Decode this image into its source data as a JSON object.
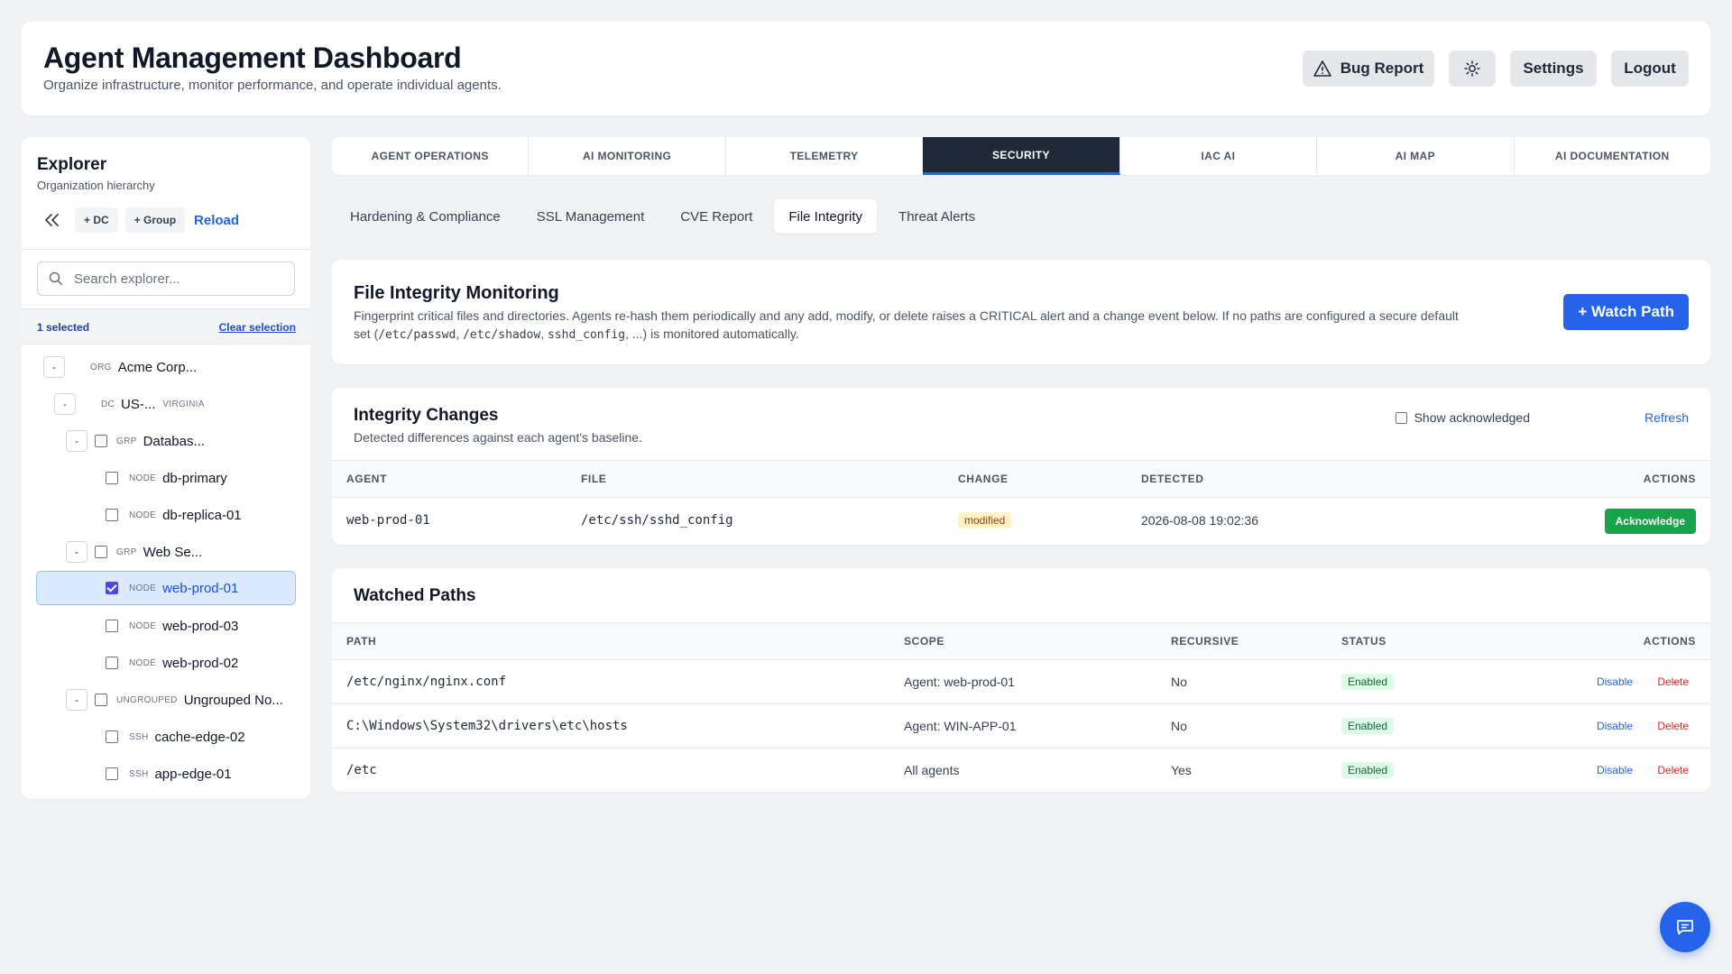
{
  "header": {
    "title": "Agent Management Dashboard",
    "subtitle": "Organize infrastructure, monitor performance, and operate individual agents.",
    "bug_report": "Bug Report",
    "settings": "Settings",
    "logout": "Logout"
  },
  "sidebar": {
    "title": "Explorer",
    "subtitle": "Organization hierarchy",
    "add_dc": "+ DC",
    "add_group": "+ Group",
    "reload": "Reload",
    "search_placeholder": "Search explorer...",
    "selected_count": "1 selected",
    "clear_selection": "Clear selection",
    "tree": [
      {
        "type": "ORG",
        "name": "Acme Corp...",
        "extra": ""
      },
      {
        "type": "DC",
        "name": "US-...",
        "extra": "VIRGINIA"
      },
      {
        "type": "GRP",
        "name": "Databas...",
        "extra": ""
      },
      {
        "type": "NODE",
        "name": "db-primary",
        "extra": ""
      },
      {
        "type": "NODE",
        "name": "db-replica-01",
        "extra": ""
      },
      {
        "type": "GRP",
        "name": "Web Se...",
        "extra": ""
      },
      {
        "type": "NODE",
        "name": "web-prod-01",
        "extra": ""
      },
      {
        "type": "NODE",
        "name": "web-prod-03",
        "extra": ""
      },
      {
        "type": "NODE",
        "name": "web-prod-02",
        "extra": ""
      },
      {
        "type": "UNGROUPED",
        "name": "Ungrouped No...",
        "extra": ""
      },
      {
        "type": "SSH",
        "name": "cache-edge-02",
        "extra": ""
      },
      {
        "type": "SSH",
        "name": "app-edge-01",
        "extra": ""
      }
    ]
  },
  "tabs": [
    "AGENT OPERATIONS",
    "AI MONITORING",
    "TELEMETRY",
    "SECURITY",
    "IAC AI",
    "AI MAP",
    "AI DOCUMENTATION"
  ],
  "subtabs": [
    "Hardening & Compliance",
    "SSL Management",
    "CVE Report",
    "File Integrity",
    "Threat Alerts"
  ],
  "fim": {
    "title": "File Integrity Monitoring",
    "desc_1": "Fingerprint critical files and directories. Agents re-hash them periodically and any add, modify, or delete raises a CRITICAL alert and a change event below. If no paths are configured a secure default",
    "desc_2a": "set (",
    "code_1": "/etc/passwd",
    "sep_1": ", ",
    "code_2": "/etc/shadow",
    "sep_2": ", ",
    "code_3": "sshd_config",
    "desc_2b": ", ...) is monitored automatically.",
    "watch_button": "+ Watch Path"
  },
  "changes": {
    "title": "Integrity Changes",
    "subtitle": "Detected differences against each agent's baseline.",
    "show_ack": "Show acknowledged",
    "refresh": "Refresh",
    "headers": [
      "AGENT",
      "FILE",
      "CHANGE",
      "DETECTED",
      "ACTIONS"
    ],
    "rows": [
      {
        "agent": "web-prod-01",
        "file": "/etc/ssh/sshd_config",
        "change": "modified",
        "detected": "2026-08-08 19:02:36",
        "action": "Acknowledge"
      }
    ]
  },
  "watched": {
    "title": "Watched Paths",
    "headers": [
      "PATH",
      "SCOPE",
      "RECURSIVE",
      "STATUS",
      "ACTIONS"
    ],
    "rows": [
      {
        "path": "/etc/nginx/nginx.conf",
        "scope": "Agent: web-prod-01",
        "recursive": "No",
        "status": "Enabled",
        "disable": "Disable",
        "delete": "Delete"
      },
      {
        "path": "C:\\Windows\\System32\\drivers\\etc\\hosts",
        "scope": "Agent: WIN-APP-01",
        "recursive": "No",
        "status": "Enabled",
        "disable": "Disable",
        "delete": "Delete"
      },
      {
        "path": "/etc",
        "scope": "All agents",
        "recursive": "Yes",
        "status": "Enabled",
        "disable": "Disable",
        "delete": "Delete"
      }
    ]
  },
  "colors": {
    "accent": "#2563eb",
    "active_tab": "#1f2937",
    "success": "#16a34a",
    "danger": "#dc2626"
  }
}
